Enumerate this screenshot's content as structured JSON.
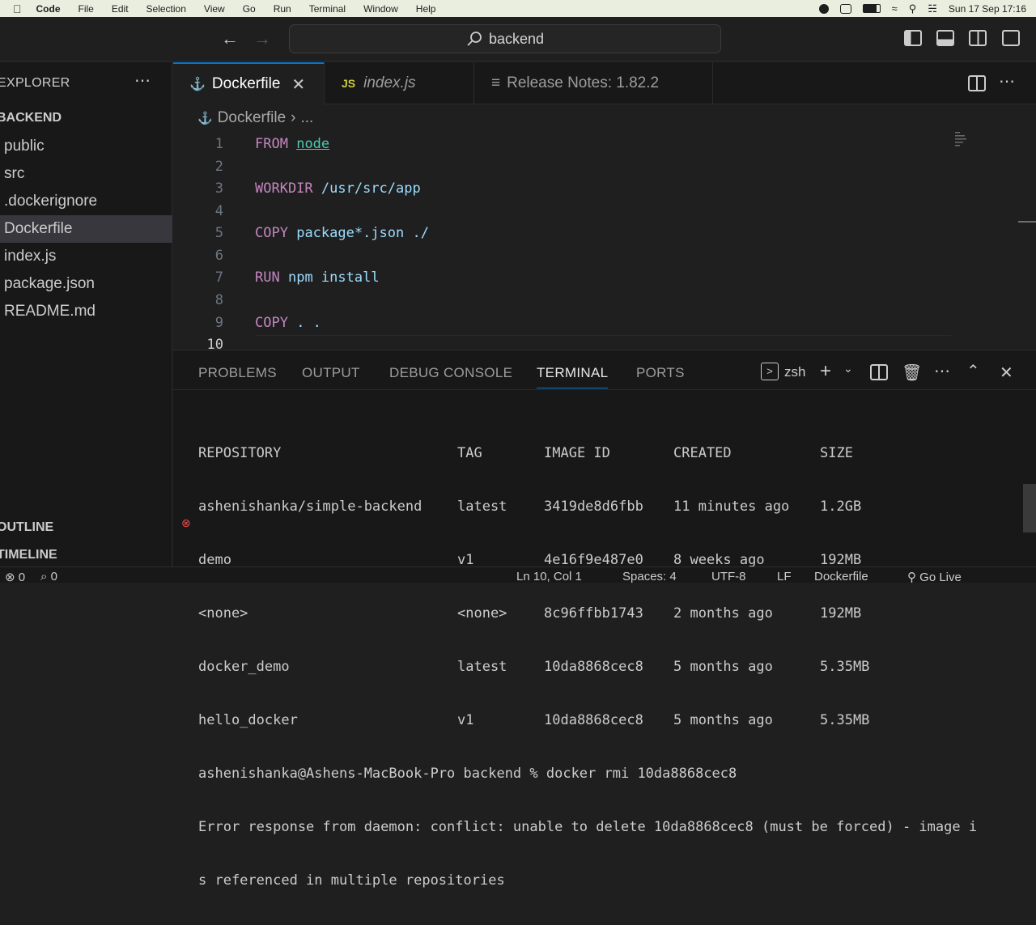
{
  "menubar": {
    "app": "Code",
    "items": [
      "File",
      "Edit",
      "Selection",
      "View",
      "Go",
      "Run",
      "Terminal",
      "Window",
      "Help"
    ],
    "datetime": "Sun 17 Sep  17:16"
  },
  "titlebar": {
    "search": "backend"
  },
  "sidebar": {
    "title": "EXPLORER",
    "project": "BACKEND",
    "items": [
      "public",
      "src",
      ".dockerignore",
      "Dockerfile",
      "index.js",
      "package.json",
      "README.md"
    ],
    "selected": "Dockerfile",
    "outline": "OUTLINE",
    "timeline": "TIMELINE"
  },
  "tabs": [
    {
      "label": "Dockerfile",
      "active": true
    },
    {
      "label": "index.js",
      "active": false
    },
    {
      "label": "Release Notes: 1.82.2",
      "active": false
    }
  ],
  "breadcrumb": {
    "file": "Dockerfile",
    "more": "..."
  },
  "editor": {
    "lines": [
      "1",
      "2",
      "3",
      "4",
      "5",
      "6",
      "7",
      "8",
      "9",
      "10"
    ],
    "code": {
      "l1_kw": "FROM",
      "l1_arg": "node",
      "l3_kw": "WORKDIR",
      "l3_arg": "/usr/src/app",
      "l5_kw": "COPY",
      "l5_arg": "package*.json ./",
      "l7_kw": "RUN",
      "l7_arg": "npm install",
      "l9_kw": "COPY",
      "l9_arg": ". ."
    }
  },
  "panel": {
    "tabs": [
      "PROBLEMS",
      "OUTPUT",
      "DEBUG CONSOLE",
      "TERMINAL",
      "PORTS"
    ],
    "active": "TERMINAL",
    "shell": "zsh"
  },
  "terminal": {
    "headers": [
      "REPOSITORY",
      "TAG",
      "IMAGE ID",
      "CREATED",
      "SIZE"
    ],
    "rows": [
      [
        "ashenishanka/simple-backend",
        "latest",
        "3419de8d6fbb",
        "11 minutes ago",
        "1.2GB"
      ],
      [
        "demo",
        "v1",
        "4e16f9e487e0",
        "8 weeks ago",
        "192MB"
      ],
      [
        "<none>",
        "<none>",
        "8c96ffbb1743",
        "2 months ago",
        "192MB"
      ],
      [
        "docker_demo",
        "latest",
        "10da8868cec8",
        "5 months ago",
        "5.35MB"
      ],
      [
        "hello_docker",
        "v1",
        "10da8868cec8",
        "5 months ago",
        "5.35MB"
      ]
    ],
    "prompt": "ashenishanka@Ashens-MacBook-Pro backend % docker rmi 10da8868cec8",
    "error1": "Error response from daemon: conflict: unable to delete 10da8868cec8 (must be forced) - image i",
    "error2": "s referenced in multiple repositories"
  },
  "status": {
    "errors": "0",
    "ports": "0",
    "position": "Ln 10, Col 1",
    "spaces": "Spaces: 4",
    "encoding": "UTF-8",
    "eol": "LF",
    "language": "Dockerfile",
    "golive": "Go Live"
  }
}
